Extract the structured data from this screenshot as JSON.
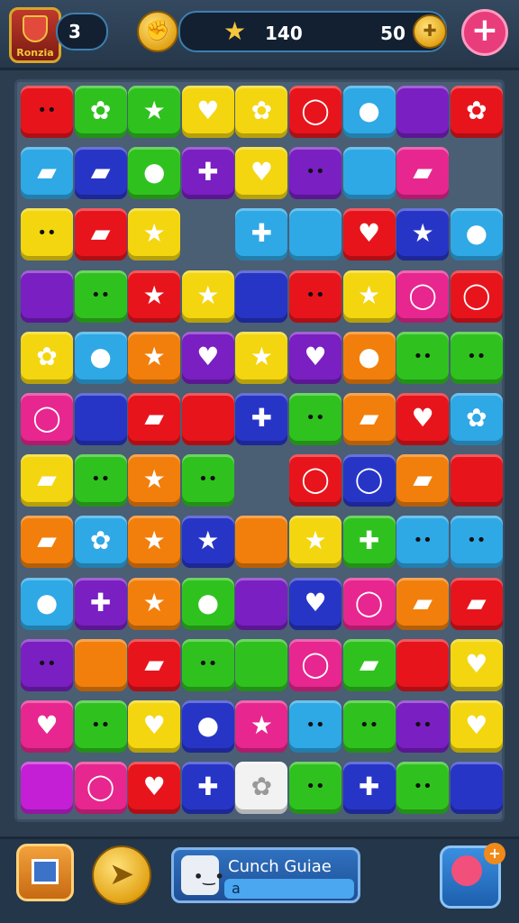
{
  "hud": {
    "crest_text": "Ronzia",
    "level": "3",
    "score": "140",
    "coins": "50",
    "add_label": "+"
  },
  "footer": {
    "guide_title": "Cunch Guiae",
    "guide_value": "a"
  },
  "palette": {
    "red": "#e8141c",
    "green": "#2fc21f",
    "yellow": "#f3d60f",
    "purple": "#7a1fc2",
    "blue": "#2fa8e6",
    "navy": "#2735c7",
    "pink": "#e8268f",
    "orange": "#f27f0c",
    "magenta": "#c51fd6"
  },
  "board": {
    "rows": [
      [
        "red:face",
        "green:splat",
        "green:star",
        "yellow:heart",
        "yellow:splat",
        "red:ring",
        "blue:drop",
        "purple:",
        "red:splat"
      ],
      [
        "blue:bar",
        "navy:bar",
        "green:drop",
        "purple:cross",
        "yellow:heart",
        "purple:face",
        "blue:",
        "pink:bar",
        ""
      ],
      [
        "yellow:face",
        "red:bar",
        "yellow:star",
        "",
        "blue:cross",
        "blue:",
        "red:heart",
        "navy:star",
        "blue:drop"
      ],
      [
        "purple:",
        "green:face",
        "red:star",
        "yellow:star",
        "navy:",
        "red:face",
        "yellow:star",
        "pink:ring",
        "red:ring"
      ],
      [
        "yellow:splat",
        "blue:drop",
        "orange:star",
        "purple:heart",
        "yellow:star",
        "purple:heart",
        "orange:drop",
        "green:face",
        "green:face"
      ],
      [
        "pink:ring",
        "navy:",
        "red:bar",
        "red:",
        "navy:cross",
        "green:face",
        "orange:bar",
        "red:heart",
        "blue:splat"
      ],
      [
        "yellow:bar",
        "green:face",
        "orange:star",
        "green:face",
        "",
        "red:ring",
        "navy:ring",
        "orange:bar",
        "red:"
      ],
      [
        "orange:bar",
        "blue:splat",
        "orange:star",
        "navy:star",
        "orange:",
        "yellow:star",
        "green:cross",
        "blue:face",
        "blue:face"
      ],
      [
        "blue:drop",
        "purple:cross",
        "orange:star",
        "green:drop",
        "purple:",
        "navy:heart",
        "pink:ring",
        "orange:bar",
        "red:bar"
      ],
      [
        "purple:face",
        "orange:",
        "red:bar",
        "green:face",
        "green:",
        "pink:ring",
        "green:bar",
        "red:",
        "yellow:heart"
      ],
      [
        "pink:heart",
        "green:face",
        "yellow:heart",
        "navy:drop",
        "pink:star",
        "blue:face",
        "green:face",
        "purple:face",
        "yellow:heart"
      ],
      [
        "magenta:",
        "pink:ring",
        "red:heart",
        "navy:cross",
        "white:splat",
        "green:face",
        "navy:cross",
        "green:face",
        "navy:"
      ]
    ]
  }
}
